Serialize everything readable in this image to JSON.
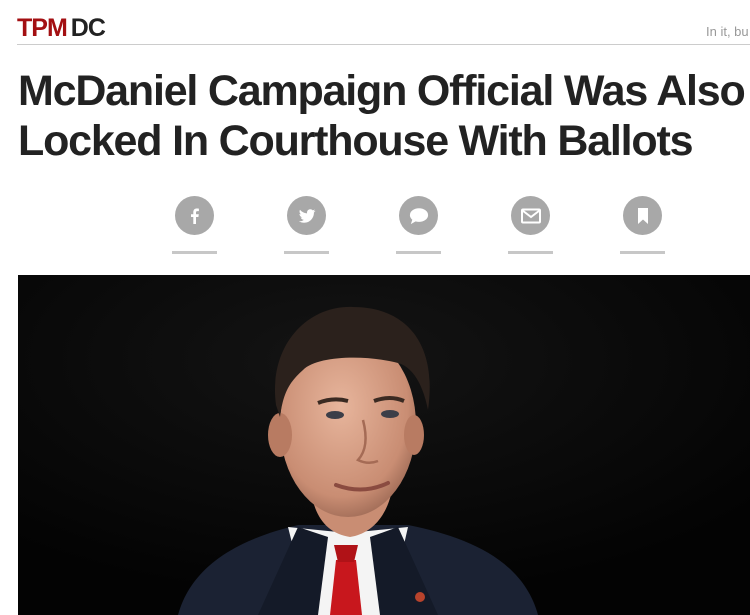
{
  "site": {
    "brand_primary": "TPM",
    "brand_secondary": "DC",
    "teaser": "In it, bu",
    "brand_color": "#a30f12"
  },
  "article": {
    "headline": "McDaniel Campaign Official Was Also Locked In Courthouse With Ballots"
  },
  "share": {
    "icon_color": "#a8a8a8",
    "buttons": [
      {
        "icon": "facebook-icon"
      },
      {
        "icon": "twitter-icon"
      },
      {
        "icon": "comment-icon"
      },
      {
        "icon": "email-icon"
      },
      {
        "icon": "bookmark-icon"
      }
    ]
  },
  "photo": {
    "background": "#060606"
  }
}
